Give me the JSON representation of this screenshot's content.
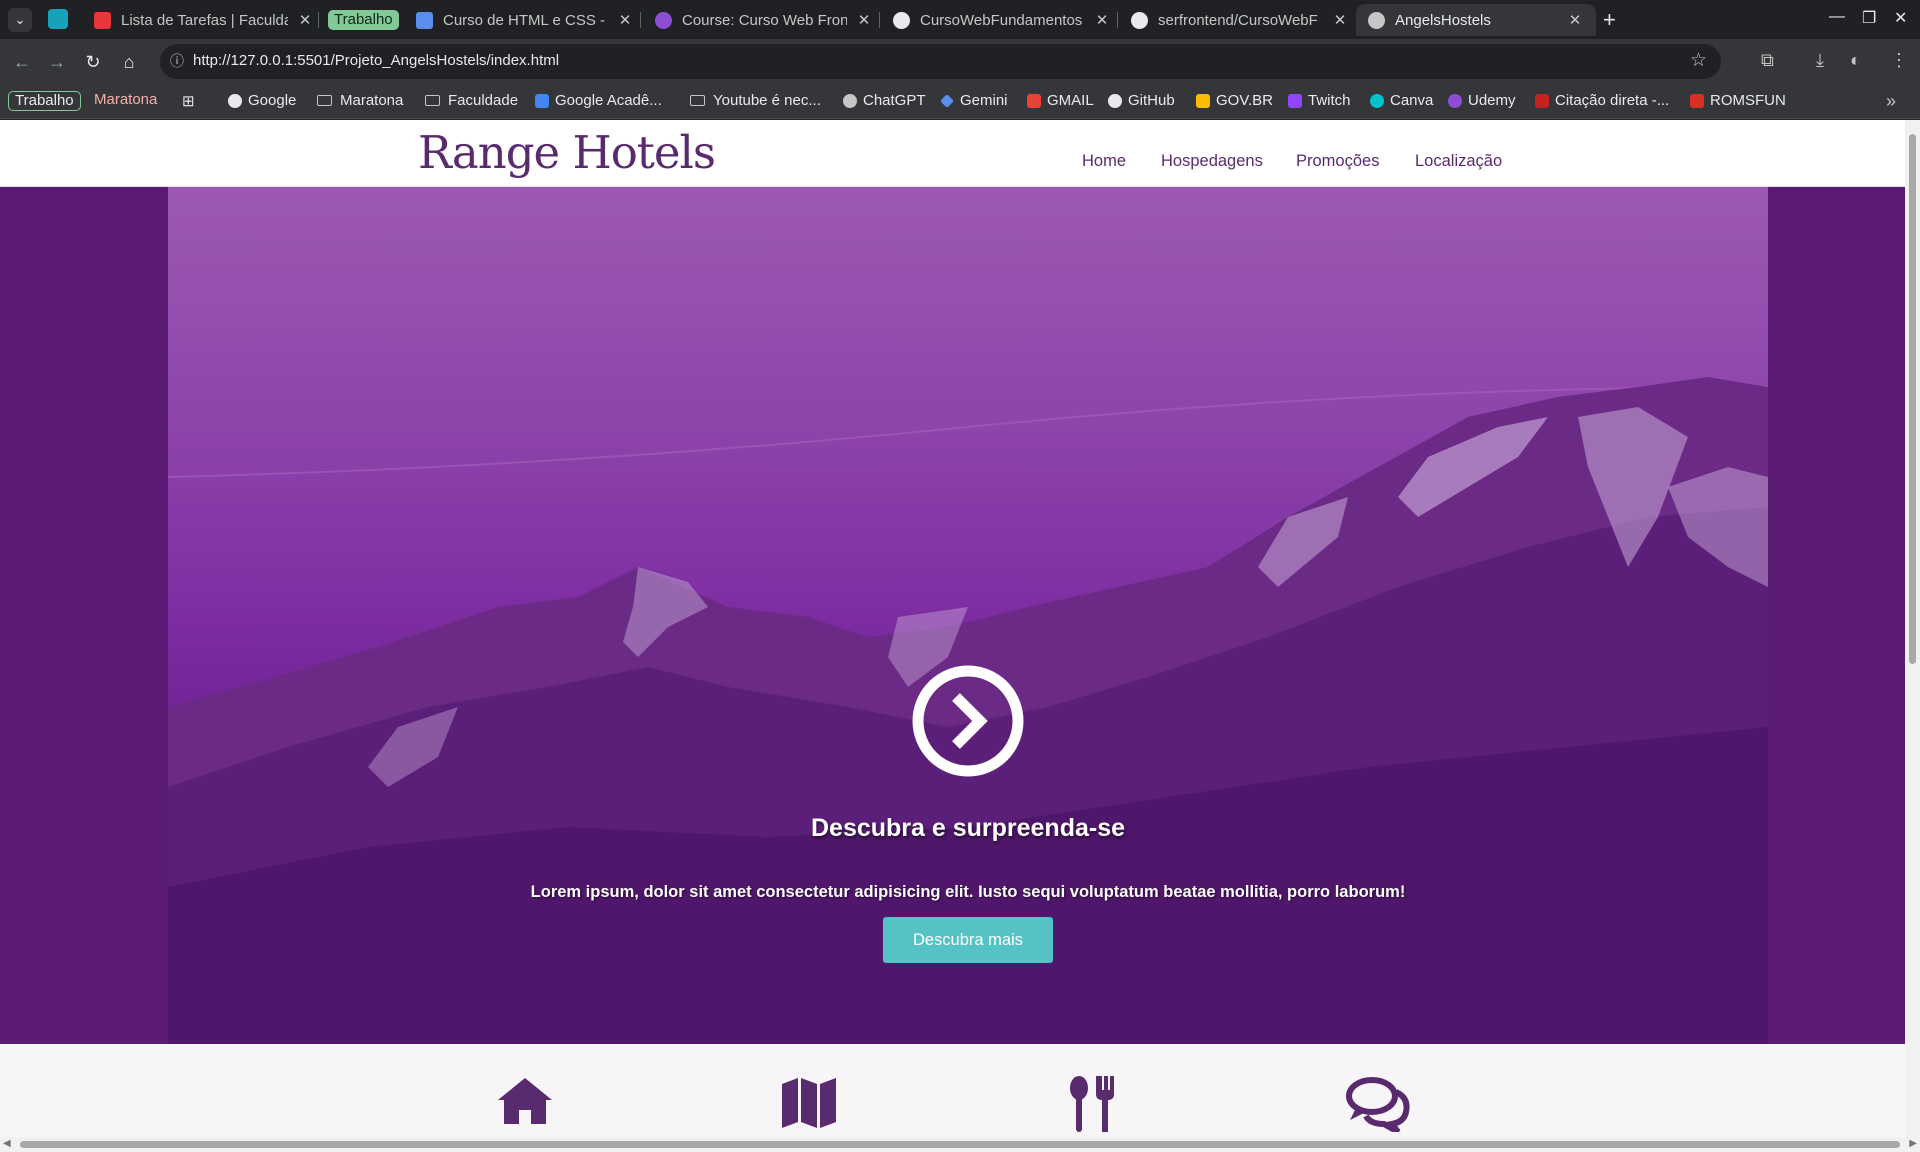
{
  "browser": {
    "tabs": [
      {
        "title": "Lista de Tarefas | Faculda",
        "favicon": "red-book-icon",
        "color": "#e8363d"
      },
      {
        "title": "Curso de HTML e CSS - A",
        "favicon": "shield-icon",
        "color": "#5b8def"
      },
      {
        "title": "Course: Curso Web Front",
        "favicon": "udemy-icon",
        "color": "#8f4dd6"
      },
      {
        "title": "CursoWebFundamentos",
        "favicon": "github-icon",
        "color": "#e8eaed"
      },
      {
        "title": "serfrontend/CursoWebF",
        "favicon": "github-icon",
        "color": "#e8eaed"
      },
      {
        "title": "AngelsHostels",
        "favicon": "globe-icon",
        "color": "#c4c7c5"
      }
    ],
    "tab_group_label": "Trabalho",
    "tab_group_color": "#81c995",
    "url": "http://127.0.0.1:5501/Projeto_AngelsHostels/index.html",
    "bookmarks": {
      "groups": [
        {
          "label": "Trabalho",
          "color": "#81c995"
        },
        {
          "label": "Maratona",
          "color": "#f28b82"
        }
      ],
      "items": [
        {
          "label": "Google",
          "icon": "google-icon"
        },
        {
          "label": "Maratona",
          "icon": "folder-icon"
        },
        {
          "label": "Faculdade",
          "icon": "folder-icon"
        },
        {
          "label": "Google Acadê...",
          "icon": "scholar-icon"
        },
        {
          "label": "Youtube é nec...",
          "icon": "folder-icon"
        },
        {
          "label": "ChatGPT",
          "icon": "chatgpt-icon"
        },
        {
          "label": "Gemini",
          "icon": "gemini-icon"
        },
        {
          "label": "GMAIL",
          "icon": "gmail-icon"
        },
        {
          "label": "GitHub",
          "icon": "github-icon"
        },
        {
          "label": "GOV.BR",
          "icon": "govbr-icon"
        },
        {
          "label": "Twitch",
          "icon": "twitch-icon"
        },
        {
          "label": "Canva",
          "icon": "canva-icon"
        },
        {
          "label": "Udemy",
          "icon": "udemy-icon"
        },
        {
          "label": "Citação direta -...",
          "icon": "citation-icon"
        },
        {
          "label": "ROMSFUN",
          "icon": "romsfun-icon"
        }
      ]
    }
  },
  "site": {
    "logo": "Range Hotels",
    "nav": [
      "Home",
      "Hospedagens",
      "Promoções",
      "Localização"
    ],
    "hero": {
      "title": "Descubra e surpreenda-se",
      "text": "Lorem ipsum, dolor sit amet consectetur adipisicing elit. Iusto sequi voluptatum beatae mollitia, porro laborum!",
      "button": "Descubra mais"
    },
    "features": [
      "home-icon",
      "map-icon",
      "utensils-icon",
      "comments-icon"
    ],
    "colors": {
      "brand": "#5a2a6e",
      "accent": "#55c3c6",
      "hero": "#7d2da1"
    }
  }
}
